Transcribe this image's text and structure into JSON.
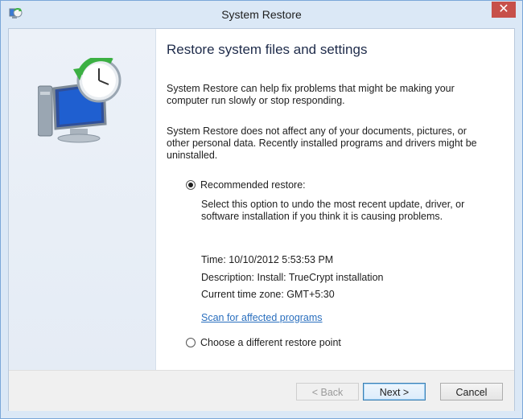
{
  "window": {
    "title": "System Restore",
    "close_glyph": "✕",
    "app_icon": "system-restore-icon"
  },
  "content": {
    "heading": "Restore system files and settings",
    "para1": "System Restore can help fix problems that might be making your computer run slowly or stop responding.",
    "para2": "System Restore does not affect any of your documents, pictures, or other personal data. Recently installed programs and drivers might be uninstalled.",
    "recommended": {
      "label": "Recommended restore:",
      "checked": true,
      "description": "Select this option to undo the most recent update, driver, or software installation if you think it is causing problems.",
      "time": "Time: 10/10/2012 5:53:53 PM",
      "desc": "Description: Install: TrueCrypt installation",
      "timezone": "Current time zone: GMT+5:30",
      "scan_link": "Scan for affected programs"
    },
    "different": {
      "label": "Choose a different restore point",
      "checked": false
    }
  },
  "buttons": {
    "back": "< Back",
    "next": "Next >",
    "cancel": "Cancel"
  },
  "colors": {
    "accent": "#2a6fbe",
    "close": "#c7504a",
    "frame": "#dbe8f6"
  }
}
